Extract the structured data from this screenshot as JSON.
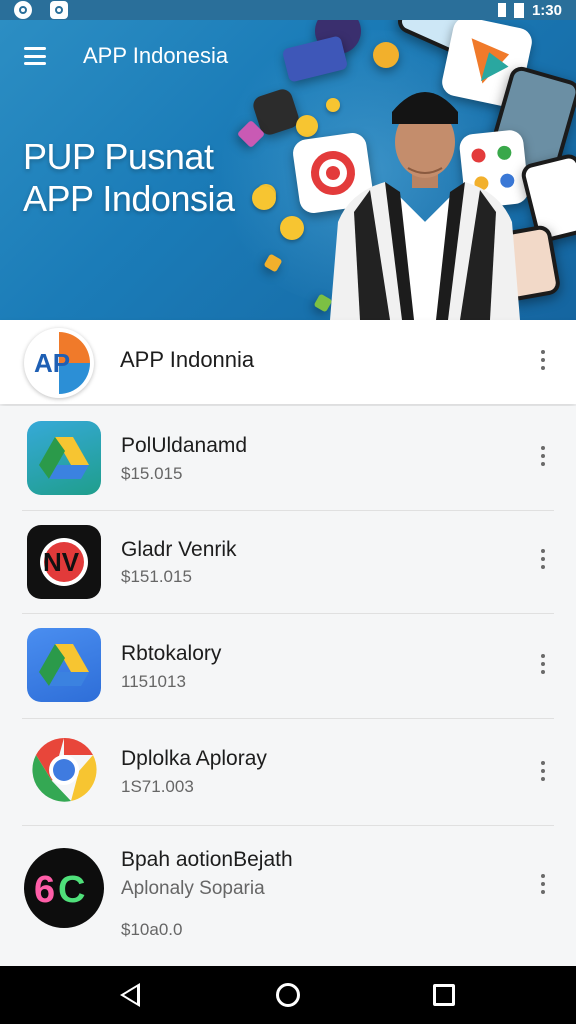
{
  "status_bar": {
    "time": "1:30"
  },
  "app_bar": {
    "title": "APP Indonesia"
  },
  "hero": {
    "title_line1": "PUP Pusnat",
    "title_line2": "APP Indonsia"
  },
  "featured": {
    "title": "APP Indonnia"
  },
  "apps": [
    {
      "name": "PolUldanamd",
      "price": "$15.015",
      "icon": "drive-icon"
    },
    {
      "name": "Gladr Venrik",
      "price": "$151.015",
      "icon": "nv-app-icon"
    },
    {
      "name": "Rbtokalory",
      "price": "1151013",
      "icon": "drive-icon"
    },
    {
      "name": "Dplolka Aploray",
      "price": "1S71.003",
      "icon": "chrome-icon"
    },
    {
      "name": "Bpah aotionBejath",
      "subtitle": "Aplonaly Soparia",
      "price": "$10a0.0",
      "icon": "6c-app-icon"
    }
  ],
  "colors": {
    "hero": "#1b7cb8",
    "navbar": "#000000",
    "accent_orange": "#f07a2a"
  }
}
